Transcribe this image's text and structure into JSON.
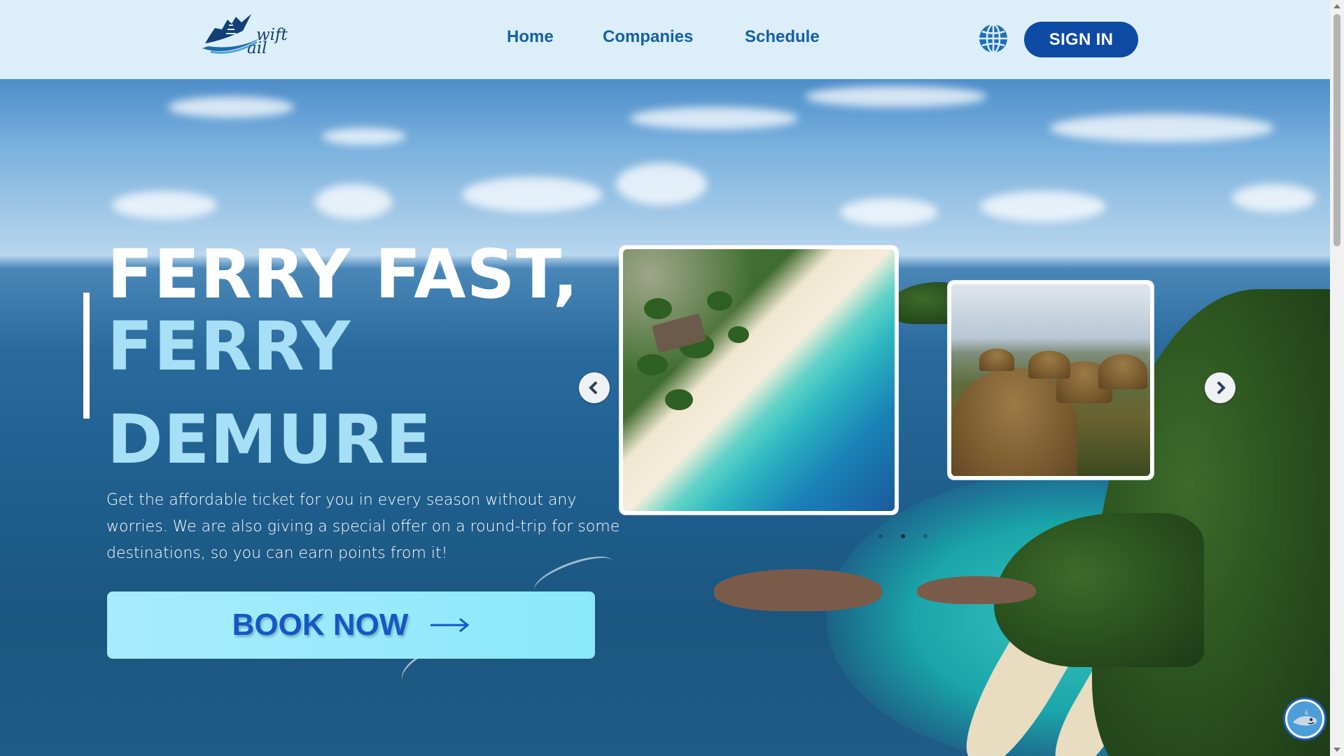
{
  "header": {
    "logo_text_line1": "wift",
    "logo_text_line2": "ail",
    "logo_icon": "ship-logo-icon",
    "nav": [
      {
        "label": "Home"
      },
      {
        "label": "Companies"
      },
      {
        "label": "Schedule"
      }
    ],
    "language_icon": "globe-icon",
    "signin_label": "SIGN IN"
  },
  "hero": {
    "headline_line1": "FERRY FAST,",
    "headline_line2": "FERRY",
    "headline_line3": "DEMURE",
    "description": "Get the affordable ticket for you in every season without any worries. We are also giving a special offer on a round-trip for some destinations, so you can earn points from it!",
    "cta_label": "BOOK NOW",
    "cta_icon": "arrow-right-icon"
  },
  "carousel": {
    "slides": [
      {
        "image": "beach-aerial-image"
      },
      {
        "image": "chocolate-hills-image"
      }
    ],
    "prev_icon": "chevron-left-icon",
    "next_icon": "chevron-right-icon",
    "dot_count": 3,
    "active_dot": 1
  },
  "chat_widget": {
    "icon": "shark-mascot-icon"
  },
  "colors": {
    "header_bg": "#dbeefa",
    "nav_text": "#1560a8",
    "signin_bg": "#0d4aa3",
    "headline_white": "#ffffff",
    "headline_blue": "#a6dff6",
    "cta_bg": "#8be8fb",
    "cta_text": "#1458c4"
  }
}
